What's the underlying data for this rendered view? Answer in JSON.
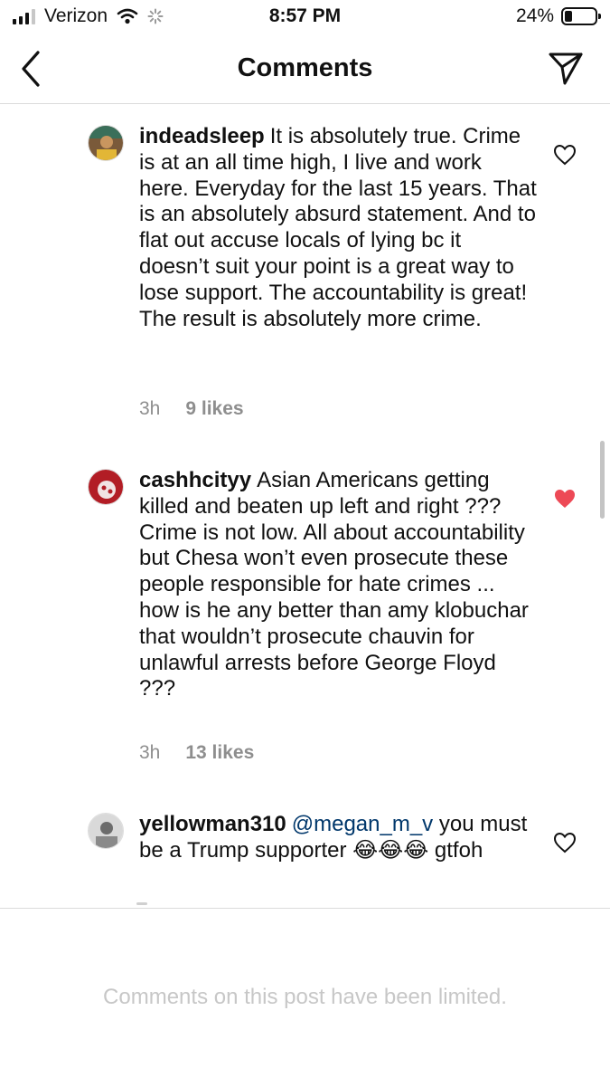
{
  "status_bar": {
    "carrier": "Verizon",
    "time": "8:57 PM",
    "battery_text": "24%",
    "battery_level": 0.24,
    "signal_bars": 3
  },
  "header": {
    "title": "Comments",
    "back_icon": "chevron-left-icon",
    "share_icon": "paper-plane-icon"
  },
  "comments": [
    {
      "username": "indeadsleep",
      "text": "It is absolutely true. Crime is at an all time high, I live and work here. Everyday for the last 15 years.  That is an absolutely absurd statement.  And to flat out accuse locals of lying bc it doesn’t suit your point is a great way to lose support.  The accountability is great! The result is absolutely more crime.",
      "time": "3h",
      "likes": "9 likes",
      "liked": false
    },
    {
      "username": "cashhcityy",
      "text": "Asian Americans getting killed and beaten up left and right ??? Crime is not low. All about accountability but Chesa won’t even prosecute these people responsible for hate crimes ... how is he any better than amy klobuchar that wouldn’t prosecute chauvin for unlawful arrests before George Floyd ???",
      "time": "3h",
      "likes": "13 likes",
      "liked": true
    },
    {
      "username": "yellowman310",
      "mention": "@megan_m_v",
      "text": "you must be a Trump supporter 😂😂😂 gtfoh",
      "liked": false
    }
  ],
  "footer": {
    "limited_message": "Comments on this post have been limited."
  },
  "colors": {
    "liked_heart": "#ed4956",
    "mention": "#00376b",
    "meta_text": "#8e8e8e",
    "limited_text": "#c7c7c7"
  }
}
